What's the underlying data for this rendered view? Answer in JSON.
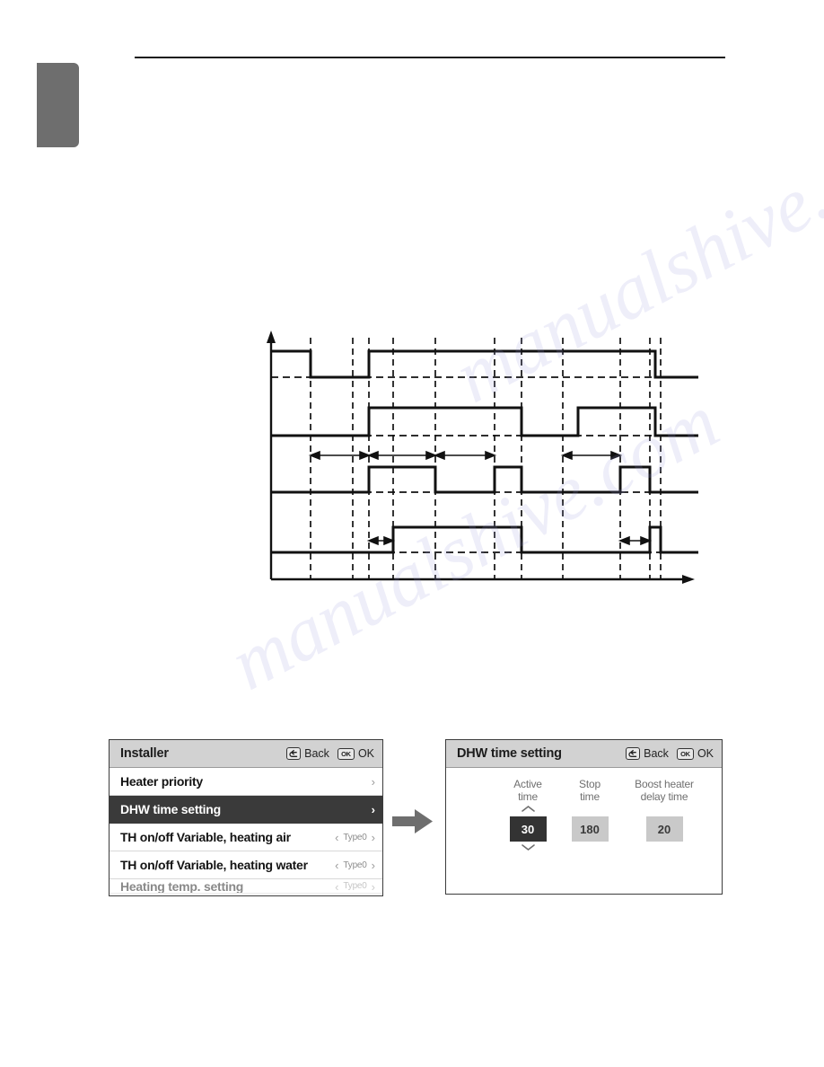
{
  "page": {
    "tab_marker": "chapter-tab",
    "rule": "header-rule",
    "watermark_text": "manualshive.com"
  },
  "diagram": {
    "type": "timing-diagram",
    "x_axis_arrow": true,
    "y_axis_arrow": true,
    "traces": 4,
    "dimension_arrows": 5,
    "line_color": "#111111",
    "dash_color": "#111111"
  },
  "left_panel": {
    "title": "Installer",
    "keys": [
      {
        "icon": "back-icon",
        "cap": "",
        "label": "Back"
      },
      {
        "icon": "ok-icon",
        "cap": "OK",
        "label": "OK"
      }
    ],
    "rows": [
      {
        "label": "Heater priority",
        "value": "",
        "chevron": "›",
        "selected": false,
        "clipped": false
      },
      {
        "label": "DHW time setting",
        "value": "",
        "chevron": "›",
        "selected": true,
        "clipped": false
      },
      {
        "label": "TH on/off Variable, heating air",
        "value": "Type0",
        "chevron": "›",
        "left_chevron": "‹",
        "selected": false,
        "clipped": false
      },
      {
        "label": "TH on/off Variable, heating water",
        "value": "Type0",
        "chevron": "›",
        "left_chevron": "‹",
        "selected": false,
        "clipped": false
      },
      {
        "label": "Heating temp. setting",
        "value": "Type0",
        "chevron": "›",
        "left_chevron": "‹",
        "selected": false,
        "clipped": true
      }
    ]
  },
  "flow": {
    "arrow_name": "flow-arrow-right",
    "color": "#6e6e6e"
  },
  "right_panel": {
    "title": "DHW time setting",
    "keys": [
      {
        "icon": "back-icon",
        "cap": "",
        "label": "Back"
      },
      {
        "icon": "ok-icon",
        "cap": "OK",
        "label": "OK"
      }
    ],
    "fields": [
      {
        "caption_line1": "Active",
        "caption_line2": "time",
        "value": "30",
        "state": "active",
        "spinner": true
      },
      {
        "caption_line1": "Stop",
        "caption_line2": "time",
        "value": "180",
        "state": "idle",
        "spinner": false
      },
      {
        "caption_line1": "Boost heater",
        "caption_line2": "delay time",
        "value": "20",
        "state": "idle",
        "spinner": false
      }
    ]
  },
  "colors": {
    "selected_row": "#3a3a3a",
    "lcd_header": "#d2d2d2",
    "value_active": "#333333",
    "value_idle": "#c9c9c9",
    "tab_gray": "#6e6e6e"
  }
}
